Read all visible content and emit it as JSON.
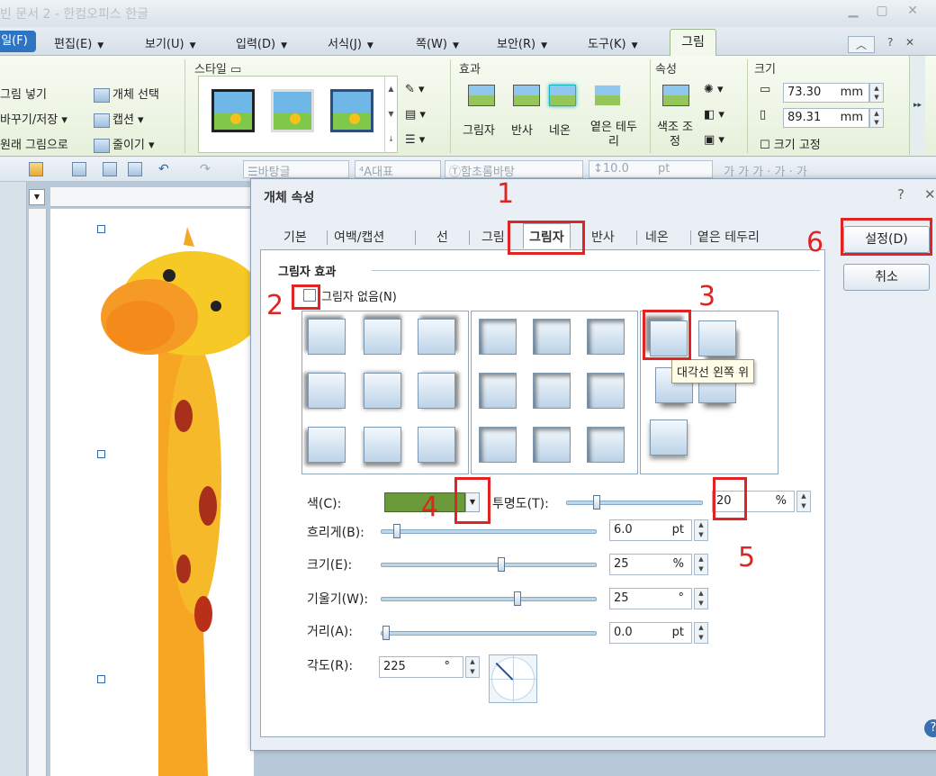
{
  "window": {
    "title": "빈 문서 2 - 한컴오피스 한글"
  },
  "menubar": {
    "file": "일(F)",
    "items": [
      "편집(E)",
      "보기(U)",
      "입력(D)",
      "서식(J)",
      "쪽(W)",
      "보안(R)",
      "도구(K)"
    ],
    "active_tab": "그림",
    "right_help": "?"
  },
  "ribbon": {
    "left_items": [
      "그림 넣기",
      "바꾸기/저장",
      "원래 그림으로"
    ],
    "mid_items": [
      "개체 선택",
      "캡션",
      "줄이기"
    ],
    "style_group": "스타일",
    "effect_group": "효과",
    "effects": [
      "그림자",
      "반사",
      "네온",
      "옅은 테두리"
    ],
    "attr_group": "속성",
    "color_adjust": "색조 조정",
    "size_group": "크기",
    "width": "73.30",
    "height": "89.31",
    "unit": "mm",
    "fix_size": "크기 고정"
  },
  "toolbar": {
    "style_combo": "바탕글",
    "rep_combo": "대표",
    "font_combo": "함초롬바탕",
    "size_combo": "10.0",
    "size_unit": "pt"
  },
  "dialog": {
    "title": "개체 속성",
    "help": "?",
    "tabs": [
      "기본",
      "여백/캡션",
      "선",
      "그림",
      "그림자",
      "반사",
      "네온",
      "옅은 테두리"
    ],
    "active_tab": "그림자",
    "group_title": "그림자 효과",
    "no_shadow": "그림자 없음(N)",
    "tooltip": "대각선 왼쪽 위",
    "color_label": "색(C):",
    "color_value": "#6a9a3a",
    "opacity_label": "투명도(T):",
    "opacity_value": "20",
    "opacity_unit": "%",
    "blur_label": "흐리게(B):",
    "blur_value": "6.0",
    "blur_unit": "pt",
    "size_label": "크기(E):",
    "size_value": "25",
    "size_unit": "%",
    "tilt_label": "기울기(W):",
    "tilt_value": "25",
    "tilt_unit": "°",
    "distance_label": "거리(A):",
    "distance_value": "0.0",
    "distance_unit": "pt",
    "angle_label": "각도(R):",
    "angle_value": "225",
    "angle_unit": "°",
    "ok": "설정(D)",
    "cancel": "취소"
  },
  "annotations": [
    "1",
    "2",
    "3",
    "4",
    "5",
    "6"
  ]
}
